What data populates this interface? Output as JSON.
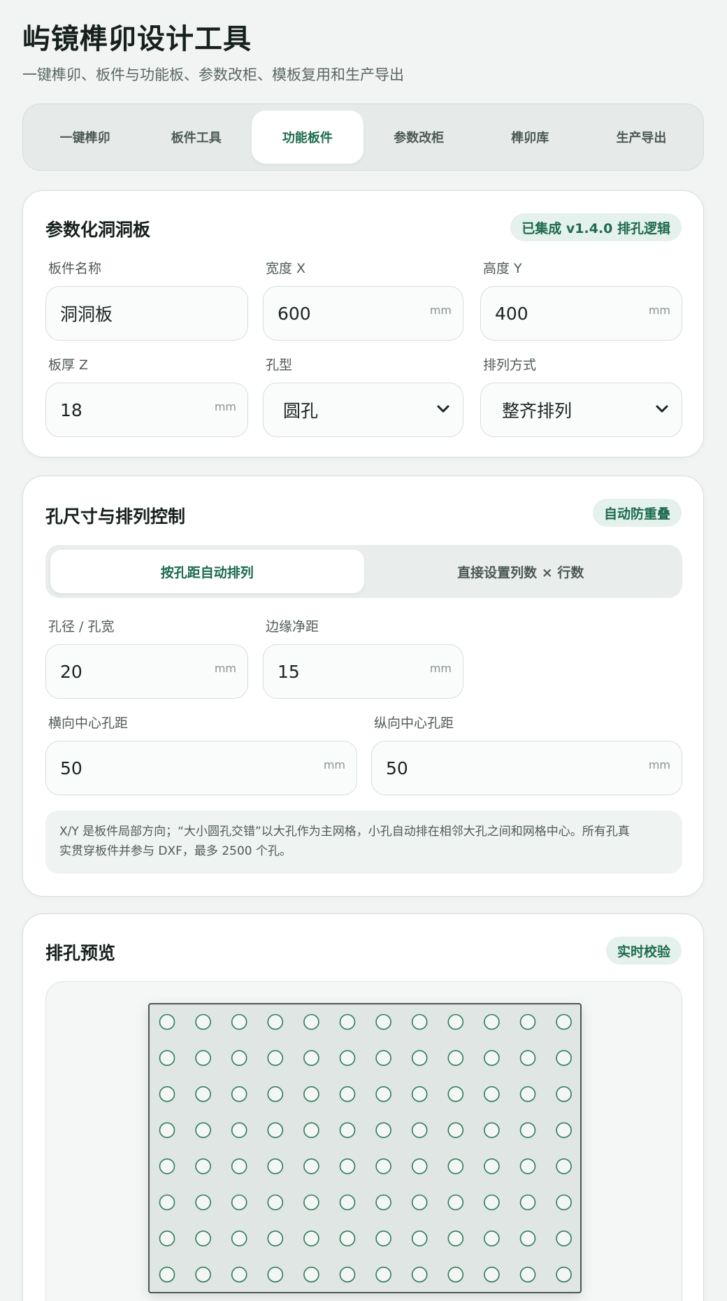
{
  "app": {
    "title": "屿镜榫卯设计工具",
    "subtitle": "一键榫卯、板件与功能板、参数改柜、模板复用和生产导出"
  },
  "tabs": [
    {
      "label": "一键榫卯",
      "active": false
    },
    {
      "label": "板件工具",
      "active": false
    },
    {
      "label": "功能板件",
      "active": true
    },
    {
      "label": "参数改柜",
      "active": false
    },
    {
      "label": "榫卯库",
      "active": false
    },
    {
      "label": "生产导出",
      "active": false
    }
  ],
  "pegboard": {
    "title": "参数化洞洞板",
    "badge": "已集成 v1.4.0 排孔逻辑",
    "fields": {
      "name": {
        "label": "板件名称",
        "value": "洞洞板"
      },
      "width": {
        "label": "宽度 X",
        "value": "600",
        "unit": "mm"
      },
      "height": {
        "label": "高度 Y",
        "value": "400",
        "unit": "mm"
      },
      "thickness": {
        "label": "板厚 Z",
        "value": "18",
        "unit": "mm"
      },
      "hole_type": {
        "label": "孔型",
        "value": "圆孔"
      },
      "layout": {
        "label": "排列方式",
        "value": "整齐排列"
      }
    }
  },
  "hole_control": {
    "title": "孔尺寸与排列控制",
    "badge": "自动防重叠",
    "mode_options": [
      {
        "label": "按孔距自动排列",
        "active": true
      },
      {
        "label": "直接设置列数 × 行数",
        "active": false
      }
    ],
    "fields": {
      "diameter": {
        "label": "孔径 / 孔宽",
        "value": "20",
        "unit": "mm"
      },
      "edge": {
        "label": "边缘净距",
        "value": "15",
        "unit": "mm"
      },
      "pitch_x": {
        "label": "横向中心孔距",
        "value": "50",
        "unit": "mm"
      },
      "pitch_y": {
        "label": "纵向中心孔距",
        "value": "50",
        "unit": "mm"
      }
    },
    "note_line1": "X/Y 是板件局部方向；“大小圆孔交错”以大孔作为主网格，小孔自动排在相邻大孔之间和网格中心。所有孔真",
    "note_line2": "实贯穿板件并参与 DXF，最多 2500 个孔。"
  },
  "preview": {
    "title": "排孔预览",
    "badge": "实时校验",
    "columns": 12,
    "rows": 8,
    "colors": {
      "hole_stroke": "#2e7d5b",
      "hole_fill": "#f3f6f5",
      "board": "#dfe6e3"
    }
  }
}
